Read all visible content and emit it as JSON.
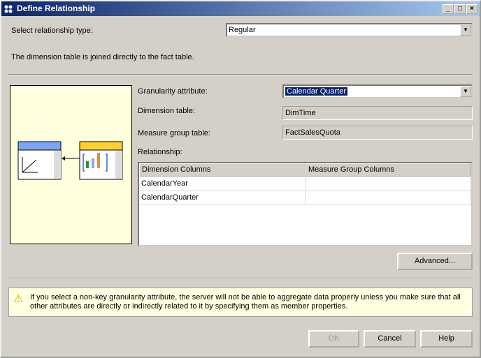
{
  "window": {
    "title": "Define Relationship"
  },
  "relationship_type": {
    "label": "Select relationship type:",
    "value": "Regular"
  },
  "description": "The dimension table is joined directly to the fact table.",
  "granularity": {
    "label": "Granularity attribute:",
    "value": "Calendar Quarter"
  },
  "dimension_table": {
    "label": "Dimension table:",
    "value": "DimTime"
  },
  "measure_group_table": {
    "label": "Measure group table:",
    "value": "FactSalesQuota"
  },
  "relationship": {
    "label": "Relationship:",
    "columns": [
      "Dimension Columns",
      "Measure Group Columns"
    ],
    "rows": [
      [
        "CalendarYear",
        ""
      ],
      [
        "CalendarQuarter",
        ""
      ]
    ]
  },
  "buttons": {
    "advanced": "Advanced...",
    "ok": "OK",
    "cancel": "Cancel",
    "help": "Help"
  },
  "warning": "If you select a non-key granularity attribute, the server will not be able to aggregate data properly unless you make sure that all other attributes are directly or indirectly related to it by specifying them as member properties."
}
